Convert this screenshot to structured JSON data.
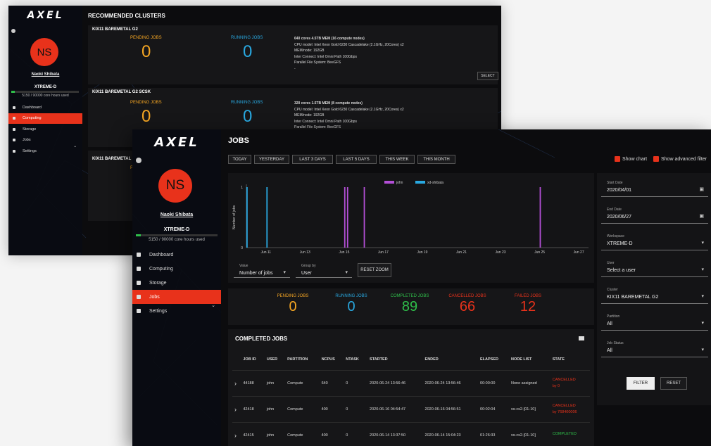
{
  "app": {
    "logo": "AXEL"
  },
  "user": {
    "initials": "NS",
    "name": "Naoki Shibata",
    "workspace": "XTREME-D",
    "hours": "5150 / 90000 core hours used",
    "hours_fraction": 0.057
  },
  "nav": [
    {
      "label": "Dashboard",
      "icon": "dashboard-icon"
    },
    {
      "label": "Computing",
      "icon": "computing-icon"
    },
    {
      "label": "Storage",
      "icon": "storage-icon"
    },
    {
      "label": "Jobs",
      "icon": "jobs-icon"
    },
    {
      "label": "Settings",
      "icon": "settings-icon"
    }
  ],
  "back": {
    "nav_active": "Computing",
    "title": "RECOMMENDED CLUSTERS",
    "clusters": [
      {
        "name": "KIX11 BAREMETAL G2",
        "pending_label": "PENDING JOBS",
        "pending": "0",
        "running_label": "RUNNING JOBS",
        "running": "0",
        "specs": [
          "640 cores 4.5TB MEM (16 compute nodes)",
          "CPU model: Intel Xeon Gold 6230 Cascadelake (2.1GHz, 20Cores) x2",
          "MEM/node: 192GB",
          "Inter Connect: Intel Omni Path 100Gbps",
          "Parallel File System: BeeGFS",
          "-"
        ],
        "select": "SELECT"
      },
      {
        "name": "KIX11 BAREMETAL G2 SCSK",
        "pending_label": "PENDING JOBS",
        "pending": "0",
        "running_label": "RUNNING JOBS",
        "running": "0",
        "specs": [
          "320 cores 1.5TB MEM (8 compute nodes)",
          "CPU model: Intel Xeon Gold 6230 Cascadelake (2.1GHz, 20Cores) x2",
          "MEM/node: 192GB",
          "Inter Connect: Intel Omni Path 100Gbps",
          "Parallel File System: BeeGFS"
        ]
      },
      {
        "name": "KIX11 BAREMETAL",
        "pending_label": "PE"
      }
    ]
  },
  "front": {
    "nav_active": "Jobs",
    "title": "JOBS",
    "range_buttons": [
      "TODAY",
      "YESTERDAY",
      "LAST 3 DAYS",
      "LAST 5 DAYS",
      "THIS WEEK",
      "THIS MONTH"
    ],
    "show_chart": "Show chart",
    "show_adv": "Show advanced filter",
    "value_label": "Value",
    "value_sel": "Number of jobs",
    "group_label": "Group by",
    "group_sel": "User",
    "reset_zoom": "RESET ZOOM",
    "stats": [
      {
        "label": "PENDING JOBS",
        "value": "0",
        "color": "#f5a623"
      },
      {
        "label": "RUNNING JOBS",
        "value": "0",
        "color": "#29a8e0"
      },
      {
        "label": "COMPLETED JOBS",
        "value": "89",
        "color": "#2fbf4a"
      },
      {
        "label": "CANCELLED JOBS",
        "value": "66",
        "color": "#e8321b"
      },
      {
        "label": "FAILED JOBS",
        "value": "12",
        "color": "#e8321b"
      }
    ],
    "completed_title": "COMPLETED JOBS",
    "columns": [
      "JOB ID",
      "USER",
      "PARTITION",
      "NCPUS",
      "NTASK",
      "STARTED",
      "ENDED",
      "ELAPSED",
      "NODE LIST",
      "STATE"
    ],
    "rows": [
      {
        "job": "44188",
        "user": "john",
        "part": "Compute",
        "ncpus": "640",
        "ntask": "0",
        "started": "2020-06-24 13:56:46",
        "ended": "2020-06-24 13:56:46",
        "elapsed": "00:00:00",
        "nodes": "None assigned",
        "state": "CANCELLED",
        "state2": "by 0",
        "state_color": "#e8321b"
      },
      {
        "job": "42418",
        "user": "john",
        "part": "Compute",
        "ncpus": "400",
        "ntask": "0",
        "started": "2020-06-16 04:54:47",
        "ended": "2020-06-16 04:56:51",
        "elapsed": "00:02:04",
        "nodes": "xs-cs2-[01-10]",
        "state": "CANCELLED",
        "state2": "by 768400006",
        "state_color": "#e8321b"
      },
      {
        "job": "42415",
        "user": "john",
        "part": "Compute",
        "ncpus": "400",
        "ntask": "0",
        "started": "2020-06-14 13:37:50",
        "ended": "2020-06-14 15:04:23",
        "elapsed": "01:26:33",
        "nodes": "xs-cs2-[01-10]",
        "state": "COMPLETED",
        "state2": "",
        "state_color": "#2fbf4a"
      }
    ],
    "filters": [
      {
        "label": "Start Date",
        "value": "2020/04/01",
        "icon": "calendar-icon"
      },
      {
        "label": "End Date",
        "value": "2020/06/27",
        "icon": "calendar-icon"
      },
      {
        "label": "Workspace",
        "value": "XTREME-D",
        "icon": "chevron-down-icon"
      },
      {
        "label": "User",
        "value": "Select a user",
        "icon": "chevron-down-icon"
      },
      {
        "label": "Cluster",
        "value": "KIX11 BAREMETAL G2",
        "icon": "chevron-down-icon"
      },
      {
        "label": "Partition",
        "value": "All",
        "icon": "chevron-down-icon"
      },
      {
        "label": "Job Status",
        "value": "All",
        "icon": "chevron-down-icon"
      }
    ],
    "filter_btn": "FILTER",
    "reset_btn": "RESET"
  },
  "chart_data": {
    "type": "bar",
    "xlabel": "",
    "ylabel": "Number of jobs",
    "ylim": [
      0,
      1
    ],
    "yticks": [
      "0",
      "1"
    ],
    "x_ticks": [
      "Jun 11",
      "Jun 13",
      "Jun 15",
      "Jun 17",
      "Jun 19",
      "Jun 21",
      "Jun 23",
      "Jun 25",
      "Jun 27"
    ],
    "series": [
      {
        "name": "john",
        "color": "#b34fd6",
        "x": [
          "2020-06-15",
          "2020-06-15",
          "2020-06-16",
          "2020-06-25"
        ],
        "values": [
          1,
          1,
          1,
          1
        ]
      },
      {
        "name": "xd-shibata",
        "color": "#29a8e0",
        "x": [
          "2020-06-10",
          "2020-06-11"
        ],
        "values": [
          1,
          1
        ]
      }
    ]
  }
}
